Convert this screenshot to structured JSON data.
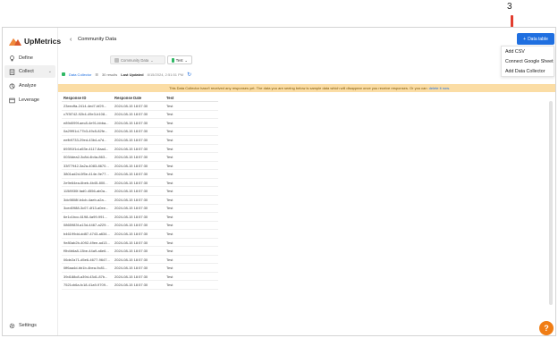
{
  "annotation": {
    "number": "3"
  },
  "sidebar": {
    "logo": "UpMetrics",
    "items": [
      {
        "label": "Define",
        "icon": "lightbulb-icon"
      },
      {
        "label": "Collect",
        "icon": "clipboard-icon"
      },
      {
        "label": "Analyze",
        "icon": "analyze-icon"
      },
      {
        "label": "Leverage",
        "icon": "leverage-icon"
      }
    ],
    "settings": "Settings"
  },
  "header": {
    "title": "Community Data",
    "data_table_button": "Data table"
  },
  "dropdown": {
    "items": [
      "Add CSV",
      "Connect Google Sheet",
      "Add Data Collector"
    ]
  },
  "chips": {
    "community": "Community Data",
    "test": "Test"
  },
  "meta": {
    "data_collector": "Data Collector",
    "results": "30 results",
    "last_updated_label": "Last Updated",
    "last_updated_value": "8/15/2024, 2:51:51 PM"
  },
  "banner": {
    "text": "This Data Collector hasn't received any responses yet. The data you are seeing below is sample data which will disappear once you receive responses. Or you can",
    "link": "delete it now."
  },
  "table": {
    "columns": [
      "Response ID",
      "Response Date",
      "Test"
    ],
    "rows": [
      [
        "23eecffa-2414-4ed7-bf29...",
        "2024-08-15 18:57:30",
        "Test"
      ],
      [
        "c7f3f742-92b4-49e3-b108...",
        "2024-08-15 18:57:30",
        "Test"
      ],
      [
        "e89d099f-aec8-4e91-bbba...",
        "2024-08-15 18:57:30",
        "Test"
      ],
      [
        "0a29f91d-77b3-49c5-82fe...",
        "2024-08-15 18:57:30",
        "Test"
      ],
      [
        "eefb9733-29ed-43b4-a7d...",
        "2024-08-15 18:57:30",
        "Test"
      ],
      [
        "69391f1d-a53e-4117-8aa4...",
        "2024-08-15 18:57:30",
        "Test"
      ],
      [
        "0034dea2-3c8d-4b4a-863...",
        "2024-08-15 18:57:30",
        "Test"
      ],
      [
        "33f77942-3a2a-4083-8670...",
        "2024-08-15 18:57:30",
        "Test"
      ],
      [
        "3801ad2d-0f5e-414e-9e77...",
        "2024-08-15 18:57:30",
        "Test"
      ],
      [
        "2e9e64ea-6beb-4b45-800...",
        "2024-08-15 18:57:30",
        "Test"
      ],
      [
        "1158930f-fad0-4556-ab0a...",
        "2024-08-15 18:57:30",
        "Test"
      ],
      [
        "3dc9808f-b4cb-4aeb-a2a...",
        "2024-08-15 18:57:30",
        "Test"
      ],
      [
        "3ced0988-3c07-4f13-a0ee...",
        "2024-08-15 18:57:30",
        "Test"
      ],
      [
        "6e1c1bcc-6198-4a99-991...",
        "2024-08-15 18:57:30",
        "Test"
      ],
      [
        "0865983f-a13d-4467-a229...",
        "2024-08-15 18:57:30",
        "Test"
      ],
      [
        "b46199dd-dd87-4743-a634...",
        "2024-08-15 18:57:30",
        "Test"
      ],
      [
        "9e80ab2b-4092-49ee-ad13...",
        "2024-08-15 18:57:30",
        "Test"
      ],
      [
        "f9b4b6a8-13be-44a9-a6e6...",
        "2024-08-15 18:57:30",
        "Test"
      ],
      [
        "06de2a71-d5e6-4677-9647...",
        "2024-08-15 18:57:30",
        "Test"
      ],
      [
        "0ff6aa4d-bb1b-4bea-9c81...",
        "2024-08-15 18:57:30",
        "Test"
      ],
      [
        "39d188c8-a39d-43d1-87b...",
        "2024-08-15 18:57:30",
        "Test"
      ],
      [
        "7521cb6a-fc18-41a9-9709...",
        "2024-08-15 18:57:30",
        "Test"
      ]
    ]
  },
  "colors": {
    "accent": "#1f6fe0",
    "banner": "#fbdda5",
    "help": "#f07d15",
    "annotation": "#e23d2f",
    "chip_community": "#bfbfbf",
    "chip_test": "#2fb864"
  }
}
